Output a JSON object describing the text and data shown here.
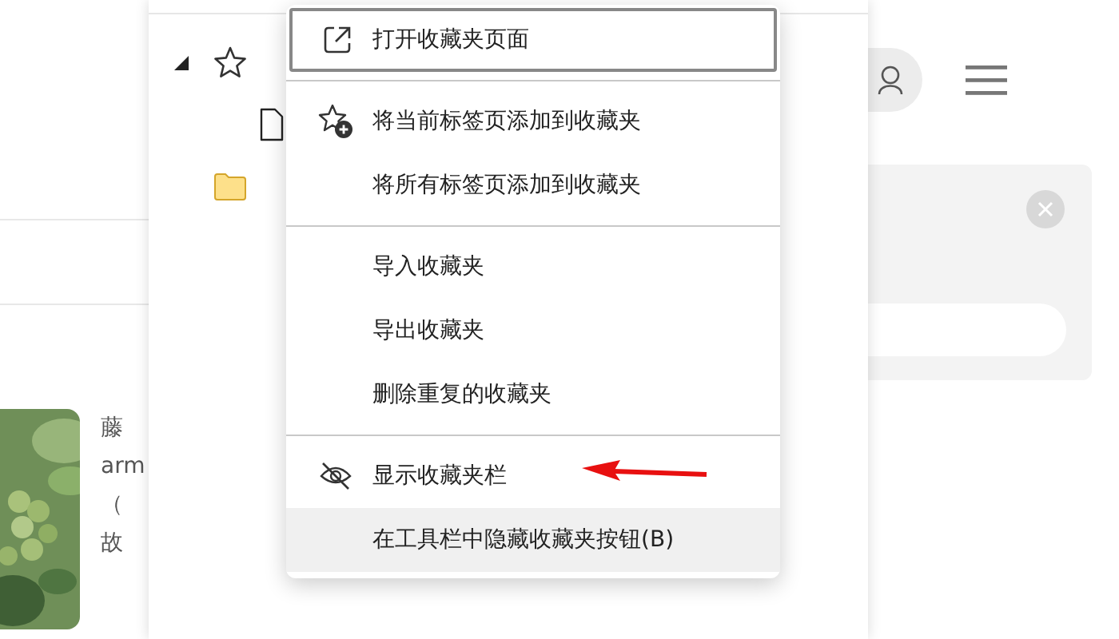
{
  "page": {
    "article_lines": [
      "藤",
      "arm",
      "（",
      "故"
    ]
  },
  "favorites_panel": {
    "tree": [
      {
        "kind": "star-folder",
        "expanded": true,
        "children": [
          {
            "kind": "page"
          }
        ]
      },
      {
        "kind": "folder"
      }
    ]
  },
  "context_menu": {
    "items": [
      {
        "kind": "external-link",
        "label": "打开收藏夹页面",
        "focused": true,
        "highlighted": false
      },
      {
        "kind": "divider"
      },
      {
        "kind": "star-add",
        "label": "将当前标签页添加到收藏夹",
        "focused": false,
        "highlighted": false
      },
      {
        "kind": "item",
        "label": "将所有标签页添加到收藏夹",
        "focused": false,
        "highlighted": false
      },
      {
        "kind": "divider"
      },
      {
        "kind": "item",
        "label": "导入收藏夹",
        "focused": false,
        "highlighted": false
      },
      {
        "kind": "item",
        "label": "导出收藏夹",
        "focused": false,
        "highlighted": false
      },
      {
        "kind": "item",
        "label": "删除重复的收藏夹",
        "focused": false,
        "highlighted": false
      },
      {
        "kind": "divider"
      },
      {
        "kind": "eye-off",
        "label": "显示收藏夹栏",
        "focused": false,
        "highlighted": false
      },
      {
        "kind": "item",
        "label": "在工具栏中隐藏收藏夹按钮(B)",
        "focused": false,
        "highlighted": true
      }
    ]
  }
}
